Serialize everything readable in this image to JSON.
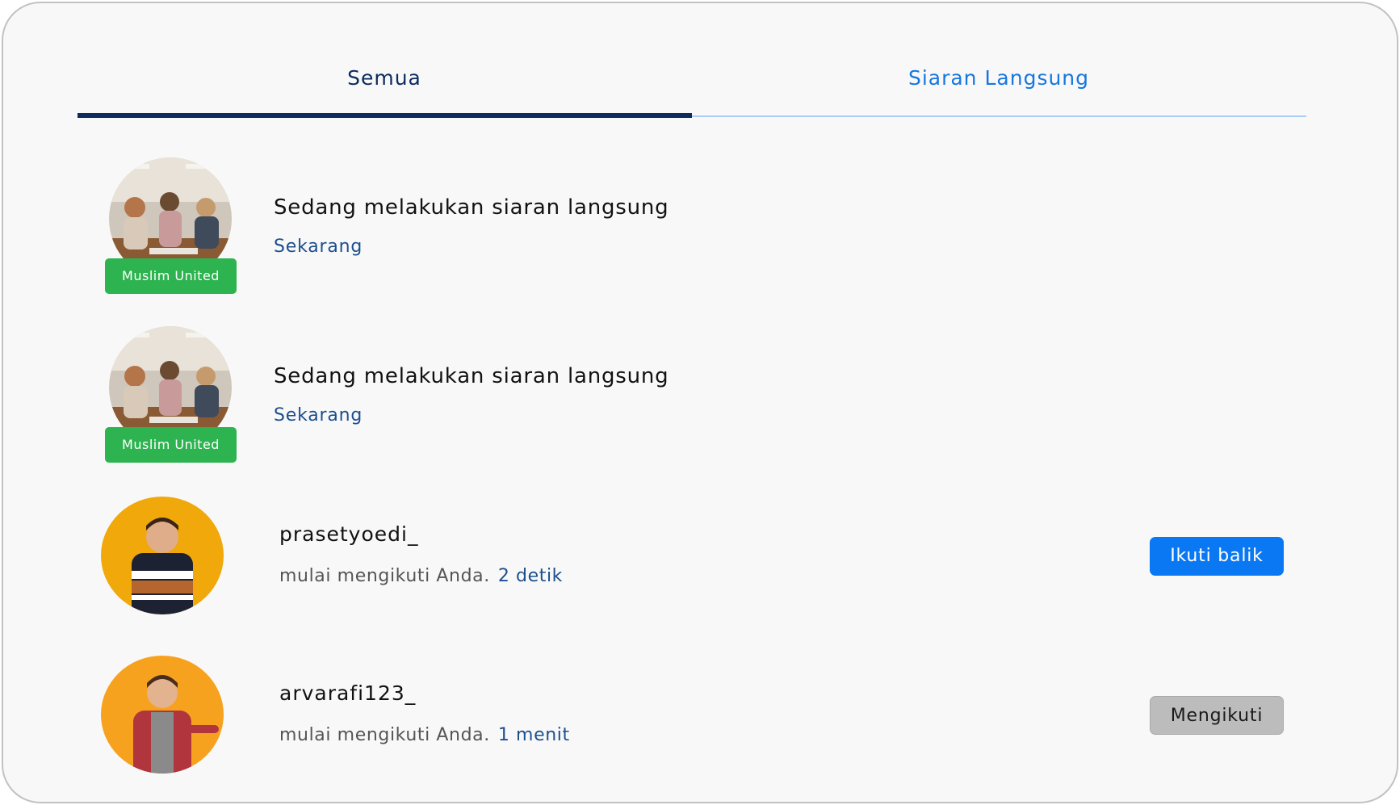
{
  "tabs": {
    "all_label": "Semua",
    "live_label": "Siaran Langsung"
  },
  "live_notifications": [
    {
      "title": "Sedang melakukan siaran langsung",
      "time": "Sekarang",
      "badge": "Muslim United"
    },
    {
      "title": "Sedang melakukan siaran langsung",
      "time": "Sekarang",
      "badge": "Muslim United"
    }
  ],
  "follow_notifications": [
    {
      "username": "prasetyoedi_",
      "message": "mulai mengikuti Anda.",
      "time": "2 detik",
      "button_label": "Ikuti balik"
    },
    {
      "username": "arvarafi123_",
      "message": "mulai mengikuti Anda.",
      "time": "1 menit",
      "button_label": "Mengikuti"
    }
  ],
  "colors": {
    "active_tab": "#0d2b5e",
    "inactive_tab": "#1677e0",
    "badge": "#2db350",
    "follow_back_button": "#0a78f2",
    "following_button": "#bcbcbc"
  }
}
